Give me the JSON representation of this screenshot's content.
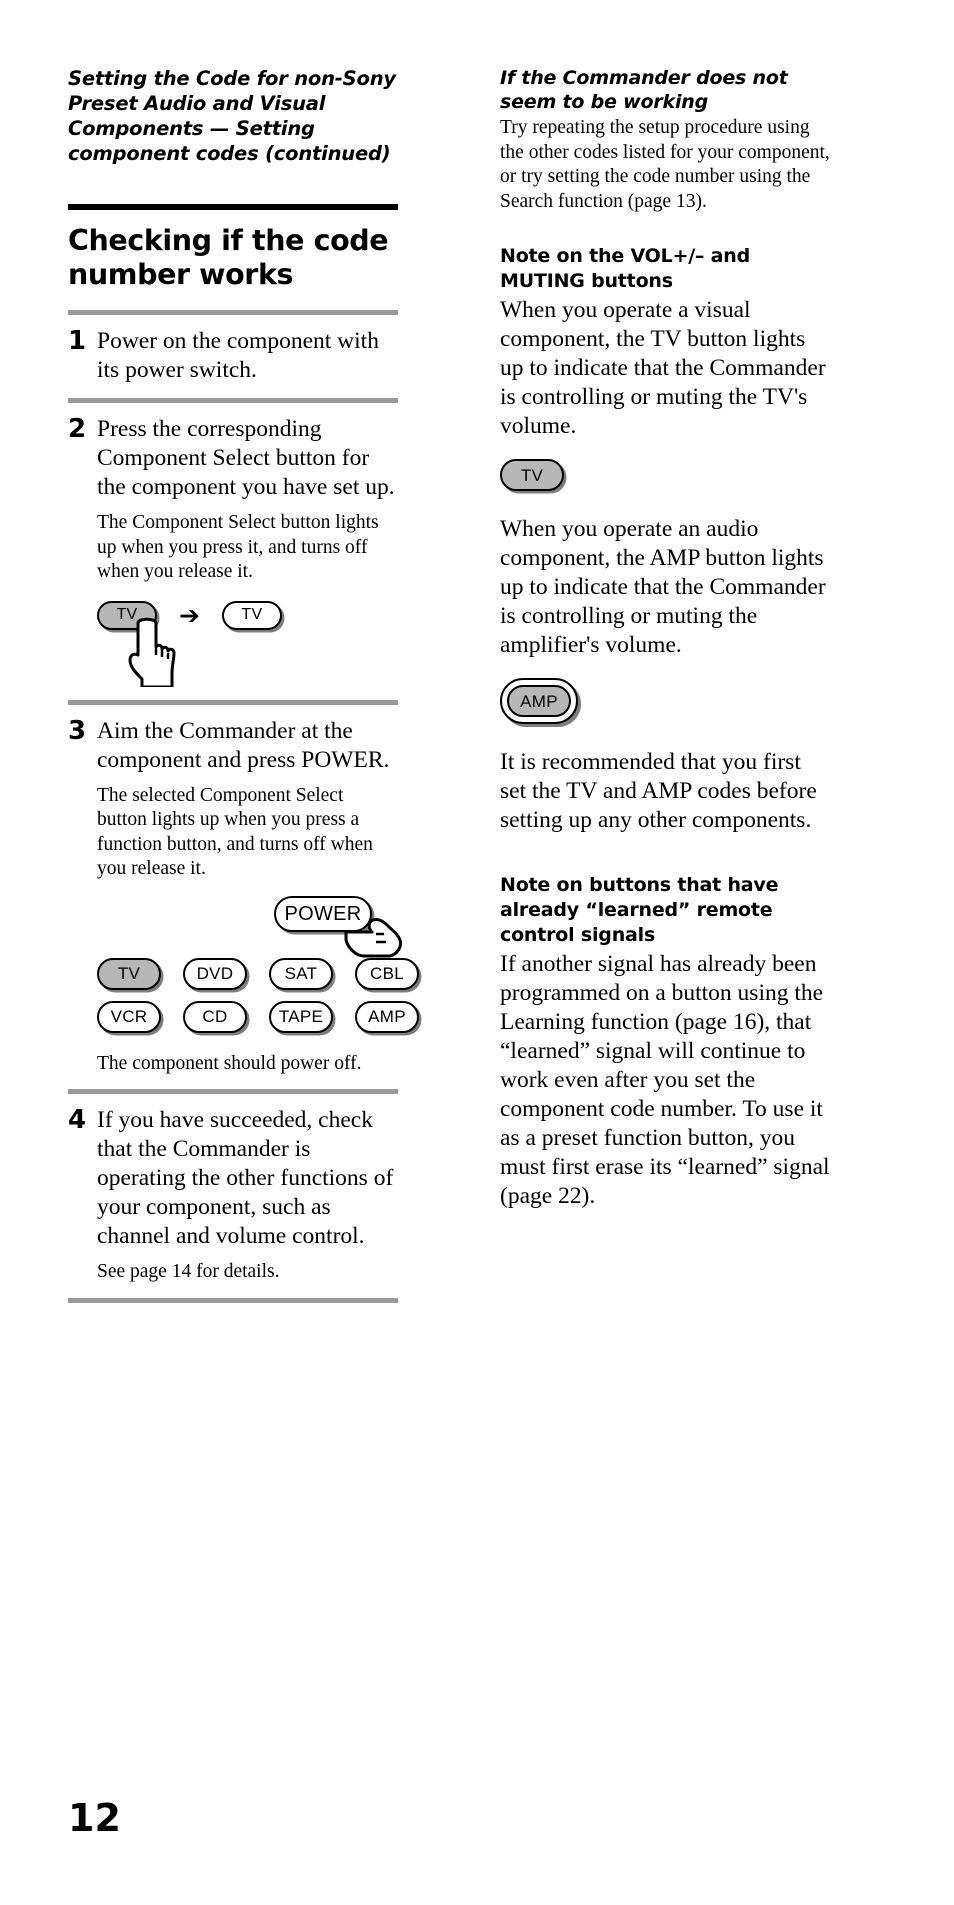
{
  "page_number": "12",
  "running_head": "Setting the Code for non-Sony Preset Audio and Visual Components — Setting component codes (continued)",
  "left_column": {
    "section_title": "Checking if the code number works",
    "steps": [
      {
        "number": "1",
        "text": "Power on the component with its power switch."
      },
      {
        "number": "2",
        "text": "Press the corresponding Component Select button for the component you have set up.",
        "note": "The Component Select button lights up when you press it, and turns off when you release it.",
        "figure": {
          "type": "press-release",
          "pressed_button": "TV",
          "arrow": "➔",
          "released_button": "TV",
          "hand_cursor": "pointing-hand"
        }
      },
      {
        "number": "3",
        "text": "Aim the Commander at the component and press POWER.",
        "note": "The selected Component Select button lights up when you press a function button, and turns off when you release it.",
        "figure": {
          "type": "remote-keypad",
          "power_button": "POWER",
          "hand_cursor": "pointing-hand",
          "rows": [
            [
              "TV",
              "DVD",
              "SAT",
              "CBL"
            ],
            [
              "VCR",
              "CD",
              "TAPE",
              "AMP"
            ]
          ],
          "lit_button": "TV"
        },
        "after_note": "The component should power off."
      },
      {
        "number": "4",
        "text": "If you have succeeded, check that the Commander is operating the other functions of your component, such as channel and volume control.",
        "note": "See page 14 for details."
      }
    ]
  },
  "right_column": {
    "blocks": [
      {
        "heading": "If the Commander does not seem to be working",
        "heading_style": "italic",
        "paragraphs": [
          "Try repeating the setup procedure using the other codes listed for your component, or try setting the code number using the Search function (page 13)."
        ]
      },
      {
        "heading": "Note on the VOL+/– and MUTING buttons",
        "heading_style": "bold",
        "paragraphs": [
          "When you operate a visual component, the TV button lights up to indicate that the Commander is controlling or muting the TV's volume."
        ],
        "figure_1": {
          "label": "TV",
          "state": "lit",
          "ring": false
        },
        "paragraphs_2": [
          "When you operate an audio component, the AMP button lights up to indicate that the Commander is controlling or muting the amplifier's volume."
        ],
        "figure_2": {
          "label": "AMP",
          "state": "lit",
          "ring": true
        },
        "paragraphs_3": [
          "It is recommended that you first set the TV and AMP codes before setting up any other components."
        ]
      },
      {
        "heading": "Note on buttons that have already “learned” remote control signals",
        "heading_style": "bold",
        "paragraphs": [
          "If another signal has already been programmed on a button using the Learning function (page 16), that “learned” signal will continue to work even after you set the component code number. To use it as a preset function button, you must first erase its “learned” signal (page 22)."
        ]
      }
    ]
  },
  "colors": {
    "rule_black": "#000000",
    "rule_gray": "#9a9a9a",
    "button_lit_fill": "#b7b7b7",
    "button_shadow": "#7d7d7d",
    "text": "#000000"
  }
}
